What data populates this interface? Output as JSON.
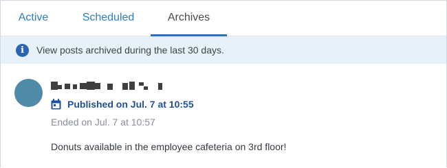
{
  "tabs": [
    {
      "label": "Active"
    },
    {
      "label": "Scheduled"
    },
    {
      "label": "Archives"
    }
  ],
  "selected_tab": "Archives",
  "banner": {
    "icon": "info-icon",
    "text": "View posts archived during the last 30 days."
  },
  "post": {
    "author_icon": "redacted-name",
    "published_icon": "calendar-icon",
    "published": "Published on Jul. 7 at 10:55",
    "ended": "Ended on Jul. 7 at 10:57",
    "body": "Donuts available in the employee cafeteria on 3rd floor!"
  },
  "colors": {
    "tab_link": "#2f7fc1",
    "tab_selected_underline": "#2f6db5",
    "banner_bg": "#e7f1fa",
    "info_icon": "#2b65b3",
    "published_text": "#1e4f9c",
    "avatar": "#4f8aa6"
  }
}
